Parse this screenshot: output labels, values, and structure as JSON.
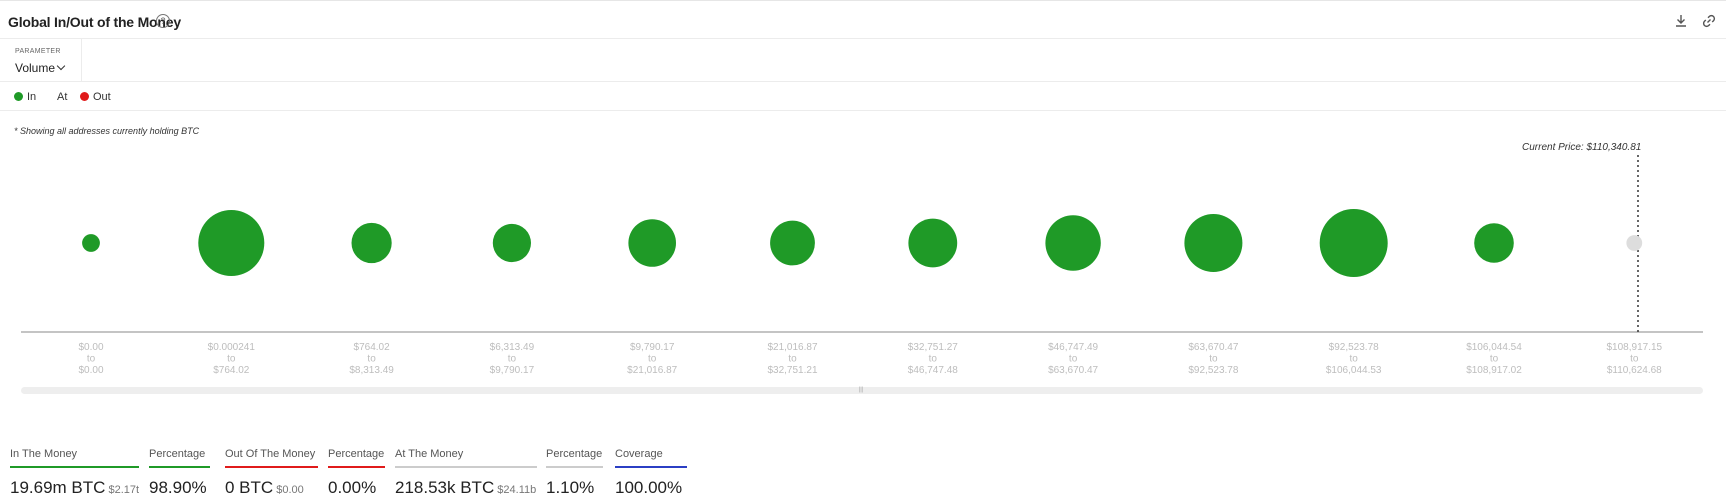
{
  "header": {
    "title": "Global In/Out of the Money",
    "help_icon": "?",
    "download_icon": "download-icon",
    "link_icon": "link-icon"
  },
  "parameter": {
    "label": "PARAMETER",
    "value": "Volume"
  },
  "legend": {
    "items": [
      {
        "label": "In",
        "color": "#1f9a27"
      },
      {
        "label": "At",
        "color": ""
      },
      {
        "label": "Out",
        "color": "#e01b1b"
      }
    ]
  },
  "note": "* Showing all addresses currently holding BTC",
  "current_price_label": "Current Price: $110,340.81",
  "chart_data": {
    "type": "scatter",
    "series": [
      {
        "name": "In",
        "color": "#1f9a27"
      },
      {
        "name": "At",
        "color": "#dddddd"
      }
    ],
    "buckets": [
      {
        "from": "$0.00",
        "to": "$0.00",
        "state": "in",
        "size": 0.27
      },
      {
        "from": "$0.000241",
        "to": "$764.02",
        "state": "in",
        "size": 1.0
      },
      {
        "from": "$764.02",
        "to": "$8,313.49",
        "state": "in",
        "size": 0.61
      },
      {
        "from": "$6,313.49",
        "to": "$9,790.17",
        "state": "in",
        "size": 0.58
      },
      {
        "from": "$9,790.17",
        "to": "$21,016.87",
        "state": "in",
        "size": 0.72
      },
      {
        "from": "$21,016.87",
        "to": "$32,751.21",
        "state": "in",
        "size": 0.68
      },
      {
        "from": "$32,751.27",
        "to": "$46,747.48",
        "state": "in",
        "size": 0.74
      },
      {
        "from": "$46,747.49",
        "to": "$63,670.47",
        "state": "in",
        "size": 0.84
      },
      {
        "from": "$63,670.47",
        "to": "$92,523.78",
        "state": "in",
        "size": 0.88
      },
      {
        "from": "$92,523.78",
        "to": "$106,044.53",
        "state": "in",
        "size": 1.03
      },
      {
        "from": "$106,044.54",
        "to": "$108,917.02",
        "state": "in",
        "size": 0.6
      },
      {
        "from": "$108,917.15",
        "to": "$110,624.68",
        "state": "at",
        "size": 0.24
      }
    ],
    "connector": "to"
  },
  "stats": [
    {
      "label": "In The Money",
      "value": "19.69m BTC",
      "sub": "$2.17t",
      "color": "#1f9a27"
    },
    {
      "label": "Percentage",
      "value": "98.90%",
      "sub": "",
      "color": "#1f9a27"
    },
    {
      "label": "Out Of The Money",
      "value": "0 BTC",
      "sub": "$0.00",
      "color": "#e01b1b"
    },
    {
      "label": "Percentage",
      "value": "0.00%",
      "sub": "",
      "color": "#e01b1b"
    },
    {
      "label": "At The Money",
      "value": "218.53k BTC",
      "sub": "$24.11b",
      "color": "#cccccc"
    },
    {
      "label": "Percentage",
      "value": "1.10%",
      "sub": "",
      "color": "#cccccc"
    },
    {
      "label": "Coverage",
      "value": "100.00%",
      "sub": "",
      "color": "#2b3fc4"
    }
  ]
}
